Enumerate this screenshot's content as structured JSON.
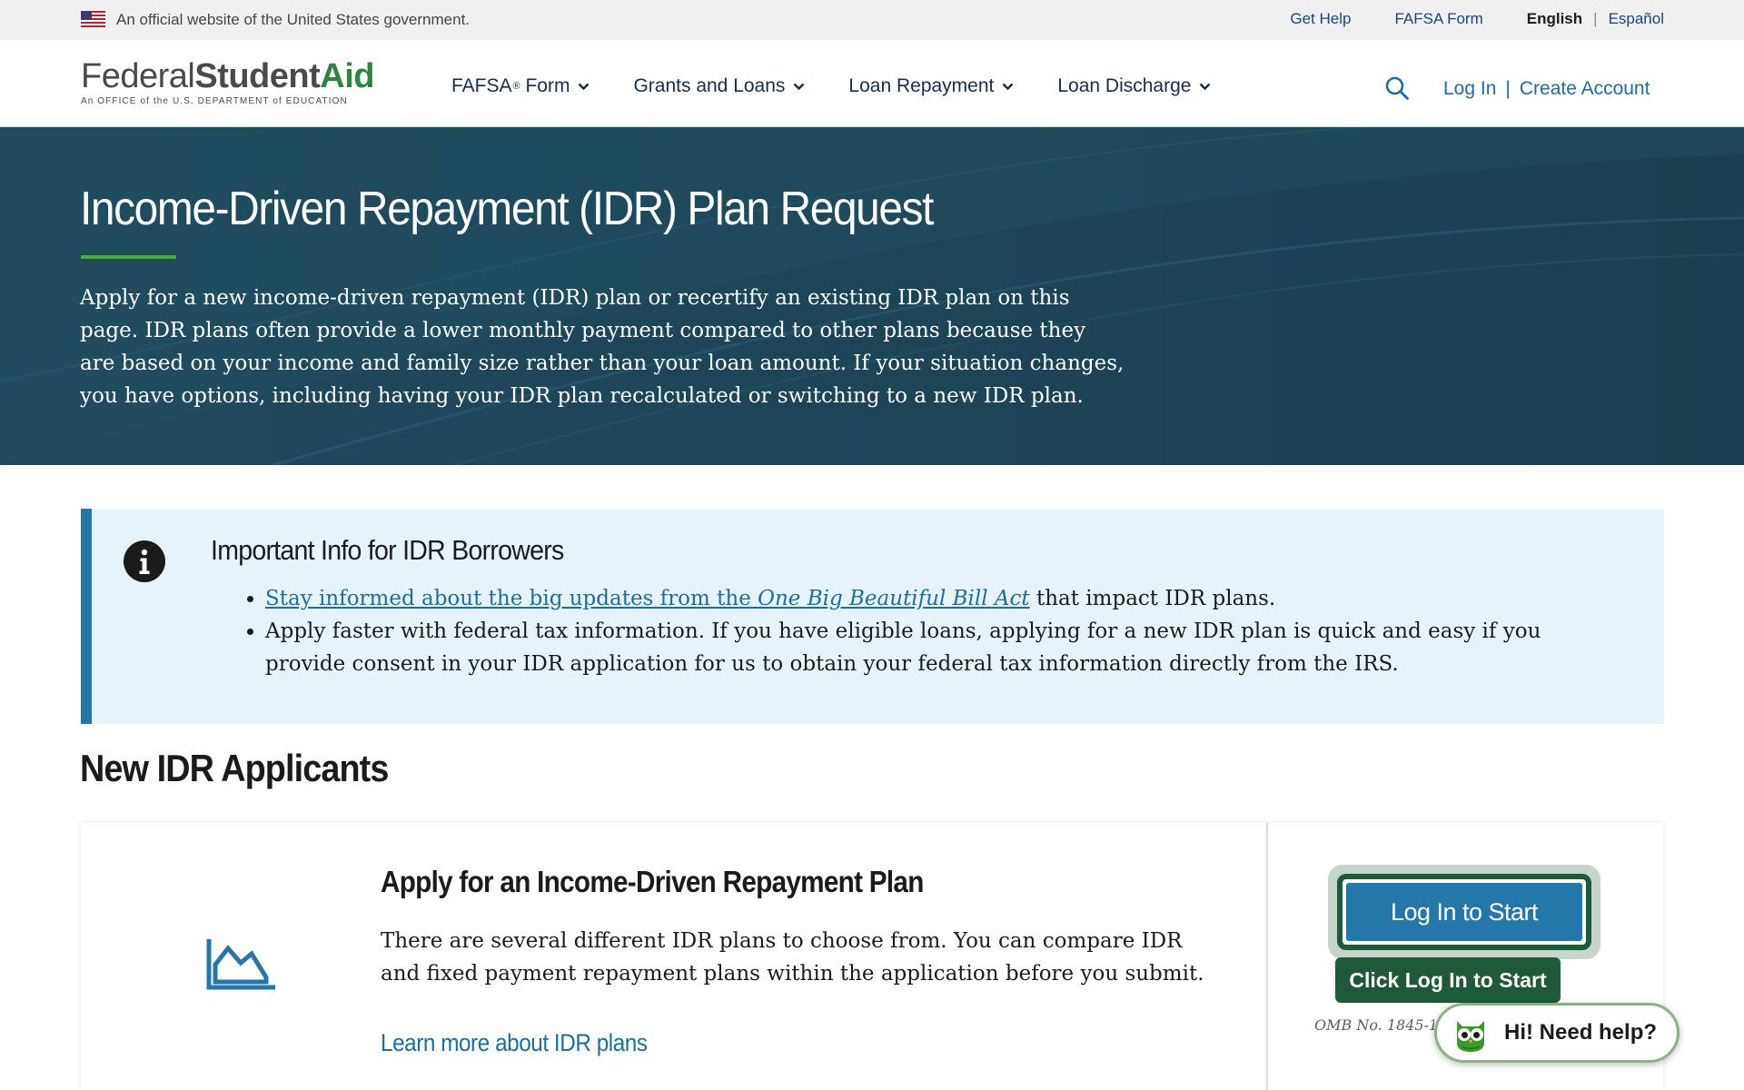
{
  "gov_banner": {
    "text": "An official website of the United States government.",
    "links": [
      "Get Help",
      "FAFSA Form"
    ],
    "lang_active": "English",
    "lang_sep": "|",
    "lang_other": "Español"
  },
  "header": {
    "logo": {
      "part1": "Federal",
      "part2": "Student",
      "part3": "Aid",
      "subtitle": "An OFFICE of the U.S. DEPARTMENT of EDUCATION"
    },
    "nav": [
      {
        "label": "FAFSA",
        "sup": "®",
        "suffix": " Form"
      },
      {
        "label": "Grants and Loans"
      },
      {
        "label": "Loan Repayment"
      },
      {
        "label": "Loan Discharge"
      }
    ],
    "login": "Log In",
    "auth_sep": "|",
    "create": "Create Account"
  },
  "hero": {
    "title": "Income-Driven Repayment (IDR) Plan Request",
    "text": "Apply for a new income-driven repayment (IDR) plan or recertify an existing IDR plan on this page. IDR plans often provide a lower monthly payment compared to other plans because they are based on your income and family size rather than your loan amount. If your situation changes, you have options, including having your IDR plan recalculated or switching to a new IDR plan."
  },
  "alert": {
    "title": "Important Info for IDR Borrowers",
    "item1": {
      "link_text": "Stay informed about the big updates from the ",
      "link_em": "One Big Beautiful Bill Act",
      "rest": " that impact IDR plans."
    },
    "item2": "Apply faster with federal tax information. If you have eligible loans, applying for a new IDR plan is quick and easy if you provide consent in your IDR application for us to obtain your federal tax information directly from the IRS."
  },
  "section": {
    "heading": "New IDR Applicants"
  },
  "card": {
    "title": "Apply for an Income-Driven Repayment Plan",
    "text": "There are several different IDR plans to choose from. You can compare IDR and fixed payment repayment plans within the application before you submit.",
    "link": "Learn more about IDR plans",
    "login_button": "Log In to Start",
    "tooltip": "Click Log In to Start",
    "omb": "OMB No. 1845-1"
  },
  "chat": {
    "label": "Hi! Need help?"
  },
  "colors": {
    "hero_bg": "#1b4353",
    "accent_green": "#4caf2a",
    "link_blue": "#1a6ea0",
    "alert_bg": "#e7f3fa",
    "alert_border": "#2378a9",
    "dark_green": "#1e5a3a"
  }
}
